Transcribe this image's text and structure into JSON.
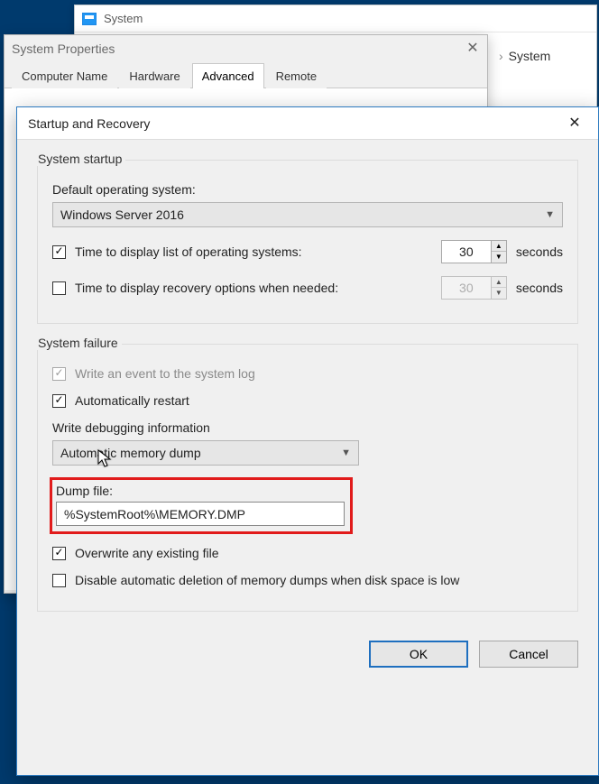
{
  "bg_window": {
    "title": "System",
    "breadcrumb": "System"
  },
  "sys_props": {
    "title": "System Properties",
    "tabs": [
      "Computer Name",
      "Hardware",
      "Advanced",
      "Remote"
    ],
    "active_tab": 2
  },
  "startup_recovery": {
    "title": "Startup and Recovery",
    "startup": {
      "legend": "System startup",
      "default_os_label": "Default operating system:",
      "default_os_value": "Windows Server 2016",
      "display_list": {
        "checked": true,
        "label": "Time to display list of operating systems:",
        "value": "30",
        "unit": "seconds"
      },
      "display_recovery": {
        "checked": false,
        "label": "Time to display recovery options when needed:",
        "value": "30",
        "unit": "seconds"
      }
    },
    "failure": {
      "legend": "System failure",
      "write_event": {
        "checked": true,
        "disabled": true,
        "label": "Write an event to the system log"
      },
      "auto_restart": {
        "checked": true,
        "label": "Automatically restart"
      },
      "write_debug_label": "Write debugging information",
      "write_debug_value": "Automatic memory dump",
      "dump_file_label": "Dump file:",
      "dump_file_value": "%SystemRoot%\\MEMORY.DMP",
      "overwrite": {
        "checked": true,
        "label": "Overwrite any existing file"
      },
      "disable_delete": {
        "checked": false,
        "label": "Disable automatic deletion of memory dumps when disk space is low"
      }
    },
    "buttons": {
      "ok": "OK",
      "cancel": "Cancel"
    }
  }
}
